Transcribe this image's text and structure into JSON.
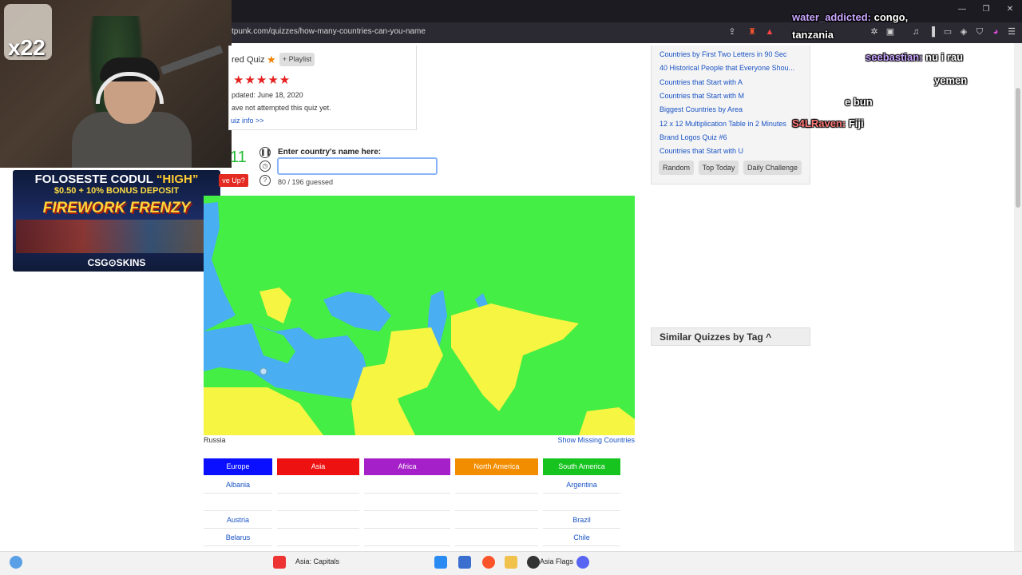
{
  "browser": {
    "url": "tpunk.com/quizzes/how-many-countries-can-you-name"
  },
  "overlay": {
    "cam_badge": "x22",
    "ad": {
      "line1_prefix": "FOLOSESTE CODUL",
      "line1_code": "“HIGH”",
      "line2": "$0.50 + 10% BONUS DEPOSIT",
      "title": "FIREWORK FRENZY",
      "brand": "CSG⊙SKINS"
    }
  },
  "quiz_info": {
    "featured": "red Quiz",
    "playlist_label": "+ Playlist",
    "rating": "★★★★★",
    "updated": "pdated: June 18, 2020",
    "attempted": "ave not attempted this quiz yet.",
    "info_link": "uiz info >>"
  },
  "quiz": {
    "score": "11",
    "give_up": "ve Up?",
    "enter_label": "Enter country's name here:",
    "input_value": "",
    "guessed": "80 / 196 guessed",
    "map_caption": "Russia",
    "show_missing": "Show Missing Countries"
  },
  "regions": [
    {
      "name": "Europe",
      "color": "#0a10ff",
      "cells": [
        "Albania",
        "",
        "Austria",
        "Belarus"
      ]
    },
    {
      "name": "Asia",
      "color": "#ee1111",
      "cells": [
        "",
        "",
        "",
        ""
      ]
    },
    {
      "name": "Africa",
      "color": "#a520c8",
      "cells": [
        "",
        "",
        "",
        ""
      ]
    },
    {
      "name": "North America",
      "color": "#f28d00",
      "cells": [
        "",
        "",
        "",
        ""
      ]
    },
    {
      "name": "South America",
      "color": "#16c31f",
      "cells": [
        "Argentina",
        "",
        "Brazil",
        "Chile"
      ]
    }
  ],
  "sidebar": {
    "links": [
      "Countries by First Two Letters in 90 Sec",
      "40 Historical People that Everyone Shou...",
      "Countries that Start with A",
      "Countries that Start with M",
      "Biggest Countries by Area",
      "12 x 12 Multiplication Table in 2 Minutes",
      "Brand Logos Quiz #6",
      "Countries that Start with U"
    ],
    "buttons": [
      "Random",
      "Top Today",
      "Daily Challenge"
    ],
    "similar_title": "Similar Quizzes by Tag ^"
  },
  "chat": [
    {
      "user": "water_addicted:",
      "msg": "congo,"
    },
    {
      "user": "",
      "msg": "tanzania"
    },
    {
      "user": "seebastian:",
      "msg": "nu i rau"
    },
    {
      "user": "",
      "msg": "yemen"
    },
    {
      "user": "",
      "msg": "e bun"
    },
    {
      "user": "S4LRaven:",
      "msg": "Fiji"
    }
  ],
  "taskbar": {
    "label": "Asia: Capitals",
    "flags_label": "Asia Flags"
  },
  "colors": {
    "map_green": "#44ee44",
    "map_blue": "#4aaef2",
    "map_yellow": "#f5f542",
    "link_blue": "#1a53c4"
  }
}
